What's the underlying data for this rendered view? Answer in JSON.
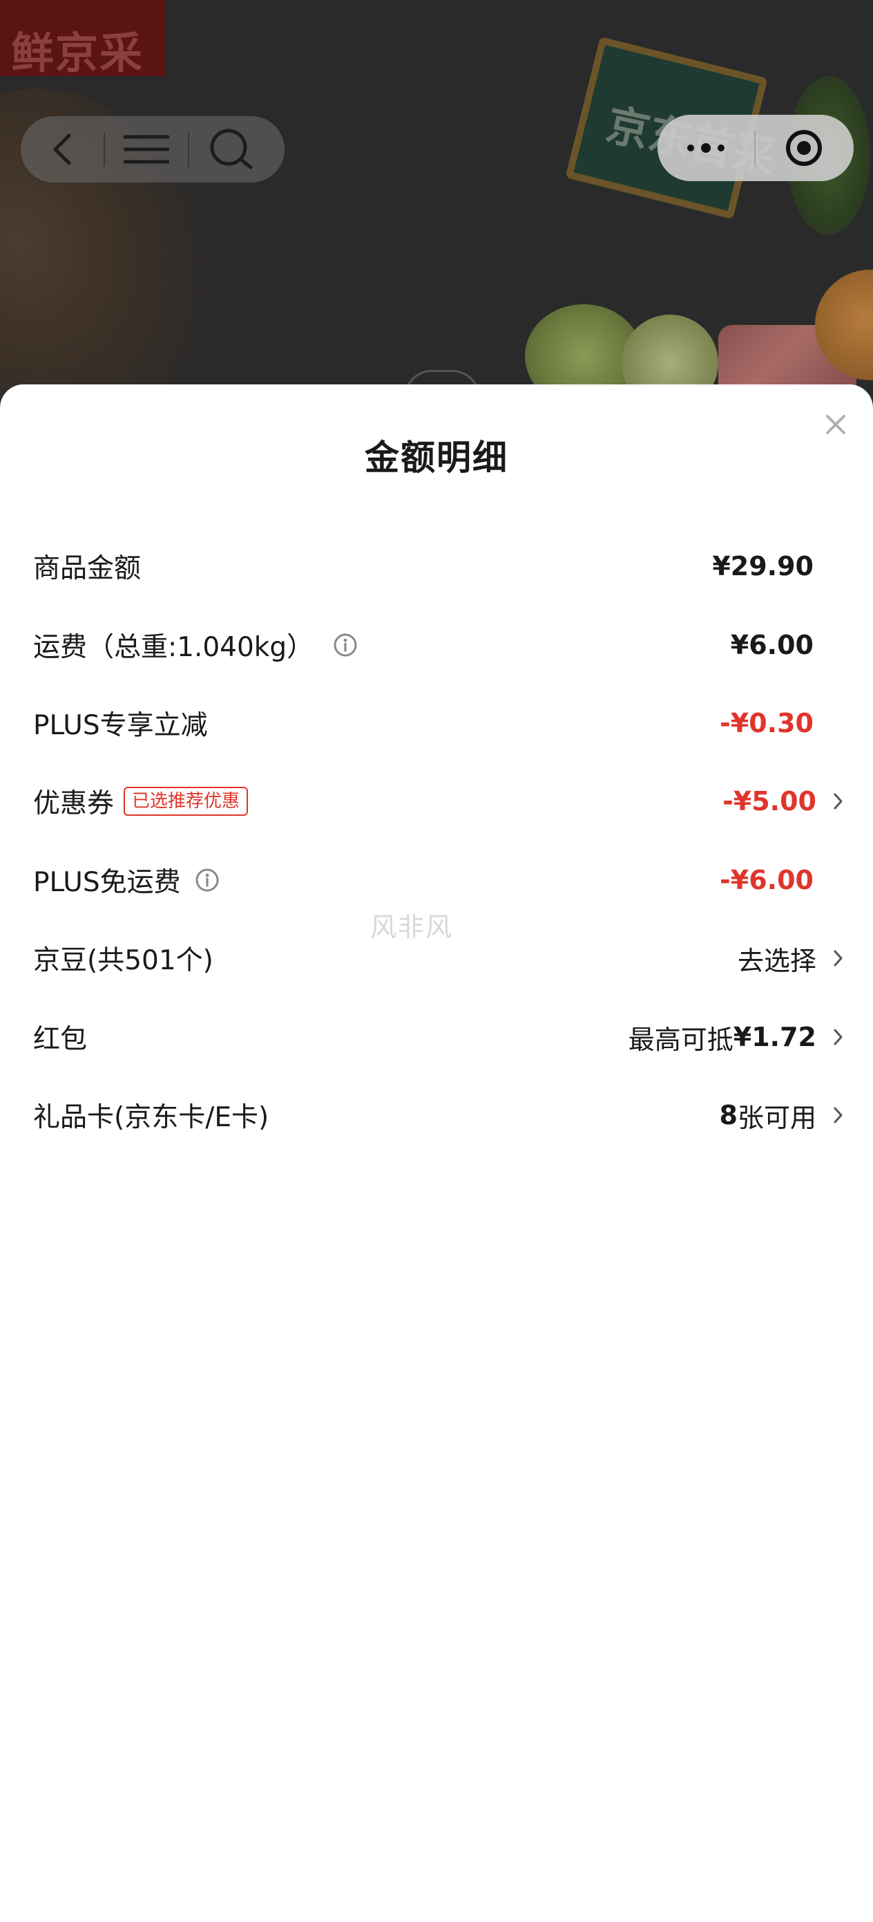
{
  "background": {
    "logo_text": "鲜京采",
    "sign_text": "京东首采"
  },
  "nav": {
    "back_icon": "chevron-left-icon",
    "menu_icon": "menu-icon",
    "search_icon": "search-icon",
    "more_icon": "more-dots-icon",
    "target_icon": "target-icon"
  },
  "sheet": {
    "title": "金额明细",
    "close_icon": "close-icon",
    "rows": [
      {
        "label": "商品金额",
        "value": "¥29.90",
        "style": "bold",
        "info": false,
        "chevron": false
      },
      {
        "label": "运费（总重:1.040kg）",
        "value": "¥6.00",
        "style": "bold",
        "info": true,
        "chevron": false
      },
      {
        "label": "PLUS专享立减",
        "value": "-¥0.30",
        "style": "red",
        "info": false,
        "chevron": false
      },
      {
        "label": "优惠券",
        "tag": "已选推荐优惠",
        "value": "-¥5.00",
        "style": "red",
        "info": false,
        "chevron": true
      },
      {
        "label": "PLUS免运费",
        "value": "-¥6.00",
        "style": "red",
        "info": true,
        "chevron": false
      },
      {
        "label": "京豆(共501个)",
        "value": "去选择",
        "style": "normal",
        "info": false,
        "chevron": true
      },
      {
        "label": "红包",
        "value_prefix": "最高可抵",
        "value": "¥1.72",
        "style": "mixed",
        "info": false,
        "chevron": true
      },
      {
        "label": "礼品卡(京东卡/E卡)",
        "value_prefix": "8",
        "value": "张可用",
        "style": "mixed-num",
        "info": false,
        "chevron": true
      }
    ]
  },
  "watermark": "风非风",
  "colors": {
    "accent_red": "#e0352b",
    "text": "#1a1a1a",
    "overlay": "#2a2a2a"
  }
}
